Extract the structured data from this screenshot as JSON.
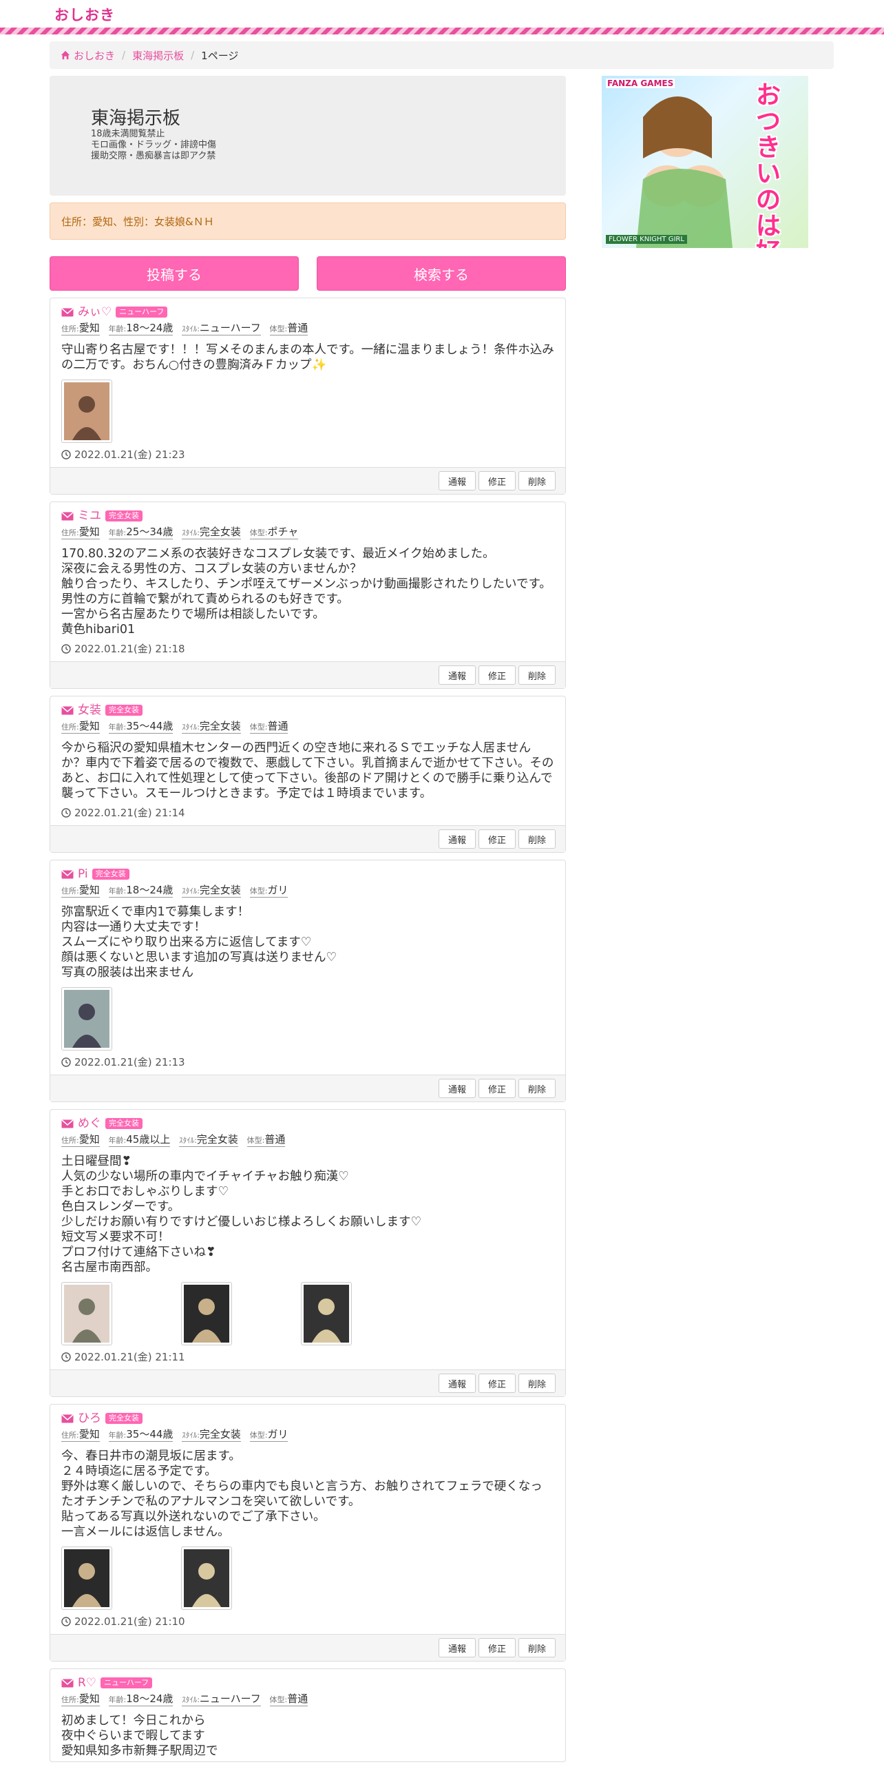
{
  "brand": "おしおき",
  "breadcrumb": {
    "home": "おしおき",
    "board": "東海掲示板",
    "page": "1ページ"
  },
  "jumbotron": {
    "title": "東海掲示板",
    "lines": [
      "18歳未満閲覧禁止",
      "モロ画像・ドラッグ・誹謗中傷",
      "援助交際・愚痴暴言は即アク禁"
    ]
  },
  "alert": "住所：愛知、性別：女装娘&ＮＨ",
  "buttons": {
    "post": "投稿する",
    "search": "検索する"
  },
  "labels": {
    "address": "住所:",
    "age": "年齢:",
    "style": "ｽﾀｲﾙ:",
    "body": "体型:",
    "report": "通報",
    "edit": "修正",
    "delete": "削除"
  },
  "posts": [
    {
      "name": "みぃ♡",
      "badge": "ニューハーフ",
      "address": "愛知",
      "age": "18〜24歳",
      "style": "ニューハーフ",
      "body": "普通",
      "message": "守山寄り名古屋です！！！写メそのまんまの本人です。一緒に温まりましょう！条件ホ込みの二万です。おちん○付きの豊胸済みＦカップ✨",
      "date": "2022.01.21(金) 21:23",
      "thumbs": 1
    },
    {
      "name": "ミユ",
      "badge": "完全女装",
      "address": "愛知",
      "age": "25〜34歳",
      "style": "完全女装",
      "body": "ポチャ",
      "message": "170.80.32のアニメ系の衣装好きなコスプレ女装です、最近メイク始めました。\n深夜に会える男性の方、コスプレ女装の方いませんか？\n触り合ったり、キスしたり、チンポ咥えてザーメンぶっかけ動画撮影されたりしたいです。\n男性の方に首輪で繋がれて責められるのも好きです。\n一宮から名古屋あたりで場所は相談したいです。\n黄色hibari01",
      "date": "2022.01.21(金) 21:18",
      "thumbs": 0
    },
    {
      "name": "女装",
      "badge": "完全女装",
      "address": "愛知",
      "age": "35〜44歳",
      "style": "完全女装",
      "body": "普通",
      "message": "今から稲沢の愛知県植木センターの西門近くの空き地に来れるＳでエッチな人居ませんか？車内で下着姿で居るので複数で、悪戯して下さい。乳首摘まんで逝かせて下さい。そのあと、お口に入れて性処理として使って下さい。後部のドア開けとくので勝手に乗り込んで襲って下さい。スモールつけときます。予定では１時頃までいます。",
      "date": "2022.01.21(金) 21:14",
      "thumbs": 0
    },
    {
      "name": "Pi",
      "badge": "完全女装",
      "address": "愛知",
      "age": "18〜24歳",
      "style": "完全女装",
      "body": "ガリ",
      "message": "弥富駅近くで車内1で募集します！\n内容は一通り大丈夫です！\nスムーズにやり取り出来る方に返信してます♡\n顔は悪くないと思います追加の写真は送りません♡\n写真の服装は出来ません",
      "date": "2022.01.21(金) 21:13",
      "thumbs": 1
    },
    {
      "name": "めぐ",
      "badge": "完全女装",
      "address": "愛知",
      "age": "45歳以上",
      "style": "完全女装",
      "body": "普通",
      "message": "土日曜昼間❣\n人気の少ない場所の車内でイチャイチャお触り痴漢♡\n手とお口でおしゃぶりします♡\n色白スレンダーです。\n少しだけお願い有りですけど優しいおじ様よろしくお願いします♡\n短文写メ要求不可！\nプロフ付けて連絡下さいね❣\n名古屋市南西部。",
      "date": "2022.01.21(金) 21:11",
      "thumbs": 3
    },
    {
      "name": "ひろ",
      "badge": "完全女装",
      "address": "愛知",
      "age": "35〜44歳",
      "style": "完全女装",
      "body": "ガリ",
      "message": "今、春日井市の潮見坂に居ます。\n２４時頃迄に居る予定です。\n野外は寒く厳しいので、そちらの車内でも良いと言う方、お触りされてフェラで硬くなったオチンチンで私のアナルマンコを突いて欲しいです。\n貼ってある写真以外送れないのでご了承下さい。\n一言メールには返信しません。",
      "date": "2022.01.21(金) 21:10",
      "thumbs": 2
    },
    {
      "name": "R♡",
      "badge": "ニューハーフ",
      "address": "愛知",
      "age": "18〜24歳",
      "style": "ニューハーフ",
      "body": "普通",
      "message": "初めまして！今日これから\n夜中ぐらいまで暇してます\n愛知県知多市新舞子駅周辺で",
      "date": "",
      "thumbs": 0
    }
  ],
  "ad": {
    "logo": "FANZA GAMES",
    "title": "おつきいのは好きですか？",
    "footer": "FLOWER KNIGHT GIRL"
  },
  "colors": {
    "accent": "#e84f9e",
    "button": "#ff66b3",
    "alert_bg": "#fde3cd",
    "alert_text": "#b0650f"
  }
}
